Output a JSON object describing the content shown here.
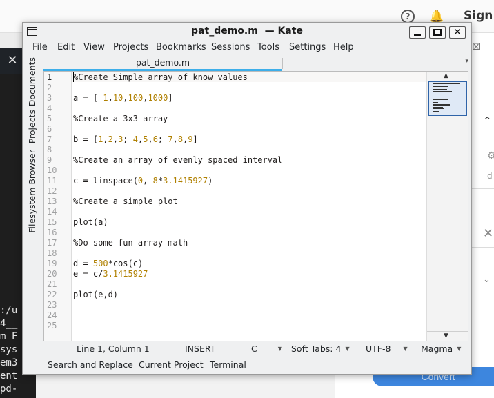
{
  "background": {
    "help_icon_glyph": "?",
    "sign_in_label": "Sign In",
    "terminal_lines": [
      ":/u",
      "4__",
      "m F",
      "sys",
      "em3",
      "ent",
      "pd-"
    ],
    "convert_label": "Convert"
  },
  "window": {
    "title": "pat_demo.m  — Kate",
    "close_glyph": "✕"
  },
  "menubar": {
    "items": [
      "File",
      "Edit",
      "View",
      "Projects",
      "Bookmarks",
      "Sessions",
      "Tools",
      "Settings",
      "Help"
    ]
  },
  "sidebar": {
    "tabs": [
      "Documents",
      "Projects",
      "Filesystem Browser"
    ]
  },
  "tabs": {
    "active": "pat_demo.m"
  },
  "editor": {
    "line_numbers": [
      "1",
      "2",
      "3",
      "4",
      "5",
      "6",
      "7",
      "8",
      "9",
      "10",
      "11",
      "12",
      "13",
      "14",
      "15",
      "16",
      "17",
      "18",
      "19",
      "20",
      "21",
      "22",
      "23",
      "24",
      "25"
    ],
    "lines": [
      "%Create Simple array of know values",
      "",
      "a = [ 1,10,100,1000]",
      "",
      "%Create a 3x3 array",
      "",
      "b = [1,2,3; 4,5,6; 7,8,9]",
      "",
      "%Create an array of evenly spaced interval",
      "",
      "c = linspace(0, 8*3.1415927)",
      "",
      "%Create a simple plot",
      "",
      "plot(a)",
      "",
      "%Do some fun array math",
      "",
      "d = 500*cos(c)",
      "e = c/3.1415927",
      "",
      "plot(e,d)",
      "",
      "",
      ""
    ],
    "number_color": "#b08000",
    "current_line": 1
  },
  "status": {
    "position": "Line 1, Column 1",
    "mode": "INSERT",
    "language": "C",
    "indent": "Soft Tabs: 4",
    "encoding": "UTF-8",
    "color_scheme": "Magma"
  },
  "bottom_tools": {
    "items": [
      "Search and Replace",
      "Current Project",
      "Terminal"
    ]
  },
  "colors": {
    "accent": "#3daee9",
    "convert_button": "#3d86de"
  }
}
